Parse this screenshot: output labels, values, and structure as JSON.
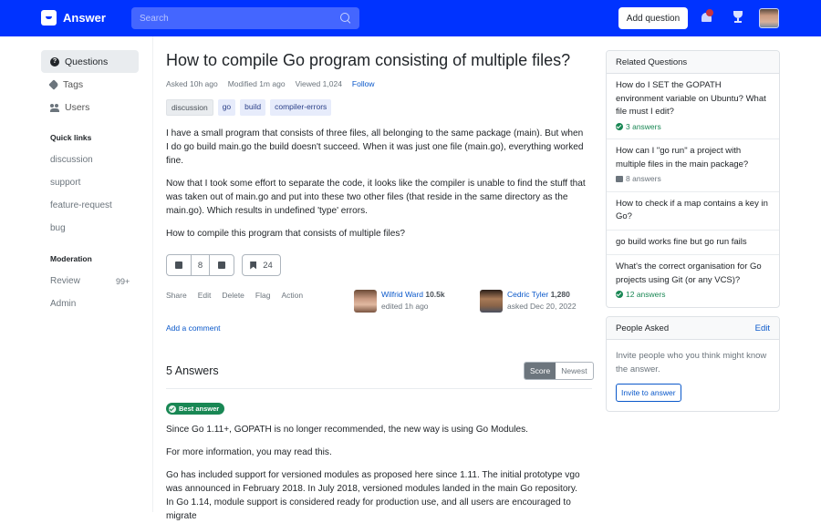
{
  "header": {
    "app_name": "Answer",
    "search_placeholder": "Search",
    "add_question_label": "Add question",
    "brand_color": "#0033ff"
  },
  "sidebar": {
    "nav": [
      {
        "label": "Questions",
        "icon": "question-circle-icon",
        "active": true
      },
      {
        "label": "Tags",
        "icon": "tag-icon",
        "active": false
      },
      {
        "label": "Users",
        "icon": "users-icon",
        "active": false
      }
    ],
    "quick_links_title": "Quick links",
    "quick_links": [
      "discussion",
      "support",
      "feature-request",
      "bug"
    ],
    "moderation_title": "Moderation",
    "moderation": [
      {
        "label": "Review",
        "badge": "99+"
      },
      {
        "label": "Admin"
      }
    ]
  },
  "question": {
    "title": "How to compile Go program consisting of multiple files?",
    "asked": "Asked 10h ago",
    "modified": "Modified 1m ago",
    "viewed": "Viewed 1,024",
    "follow": "Follow",
    "tags": [
      "discussion",
      "go",
      "build",
      "compiler-errors"
    ],
    "body": [
      "I have a small program that consists of three files, all belonging to the same package (main). But when I do go build main.go the build doesn't succeed. When it was just one file (main.go), everything worked fine.",
      "Now that I took some effort to separate the code, it looks like the compiler is unable to find the stuff that was taken out of main.go and put into these two other files (that reside in the same directory as the main.go). Which results in undefined 'type' errors.",
      "How to compile this program that consists of multiple files?"
    ],
    "votes": "8",
    "bookmarks": "24",
    "actions": [
      "Share",
      "Edit",
      "Delete",
      "Flag",
      "Action"
    ],
    "editor": {
      "name": "Wilfrid Ward",
      "rep": "10.5k",
      "sub": "edited 1h ago"
    },
    "author": {
      "name": "Cedric Tyler",
      "rep": "1,280",
      "sub": "asked Dec 20, 2022"
    },
    "add_comment": "Add a comment"
  },
  "answers": {
    "heading": "5 Answers",
    "sort_options": [
      "Score",
      "Newest"
    ],
    "sort_selected": "Score",
    "best_label": "Best answer",
    "best_body": [
      "Since Go 1.11+, GOPATH is no longer recommended, the new way is using Go Modules.",
      "For more information, you may read this.",
      "Go has included support for versioned modules as proposed here since 1.11. The initial prototype vgo was announced in February 2018. In July 2018, versioned modules landed in the main Go repository. In Go 1.14, module support is considered ready for production use, and all users are encouraged to migrate"
    ]
  },
  "related": {
    "title": "Related Questions",
    "items": [
      {
        "q": "How do I SET the GOPATH environment variable on Ubuntu? What file must I edit?",
        "answers": "3 answers",
        "accepted": true
      },
      {
        "q": "How can I \"go run\" a project with multiple files in the main package?",
        "answers": "8 answers",
        "accepted": false
      },
      {
        "q": "How to check if a map contains a key in Go?",
        "answers": null
      },
      {
        "q": "go build works fine but go run fails",
        "answers": null
      },
      {
        "q": "What's the correct organisation for Go projects using Git (or any VCS)?",
        "answers": "12 answers",
        "accepted": true
      }
    ]
  },
  "people": {
    "title": "People Asked",
    "edit": "Edit",
    "text": "Invite people who you think might know the answer.",
    "invite_label": "Invite to answer"
  }
}
